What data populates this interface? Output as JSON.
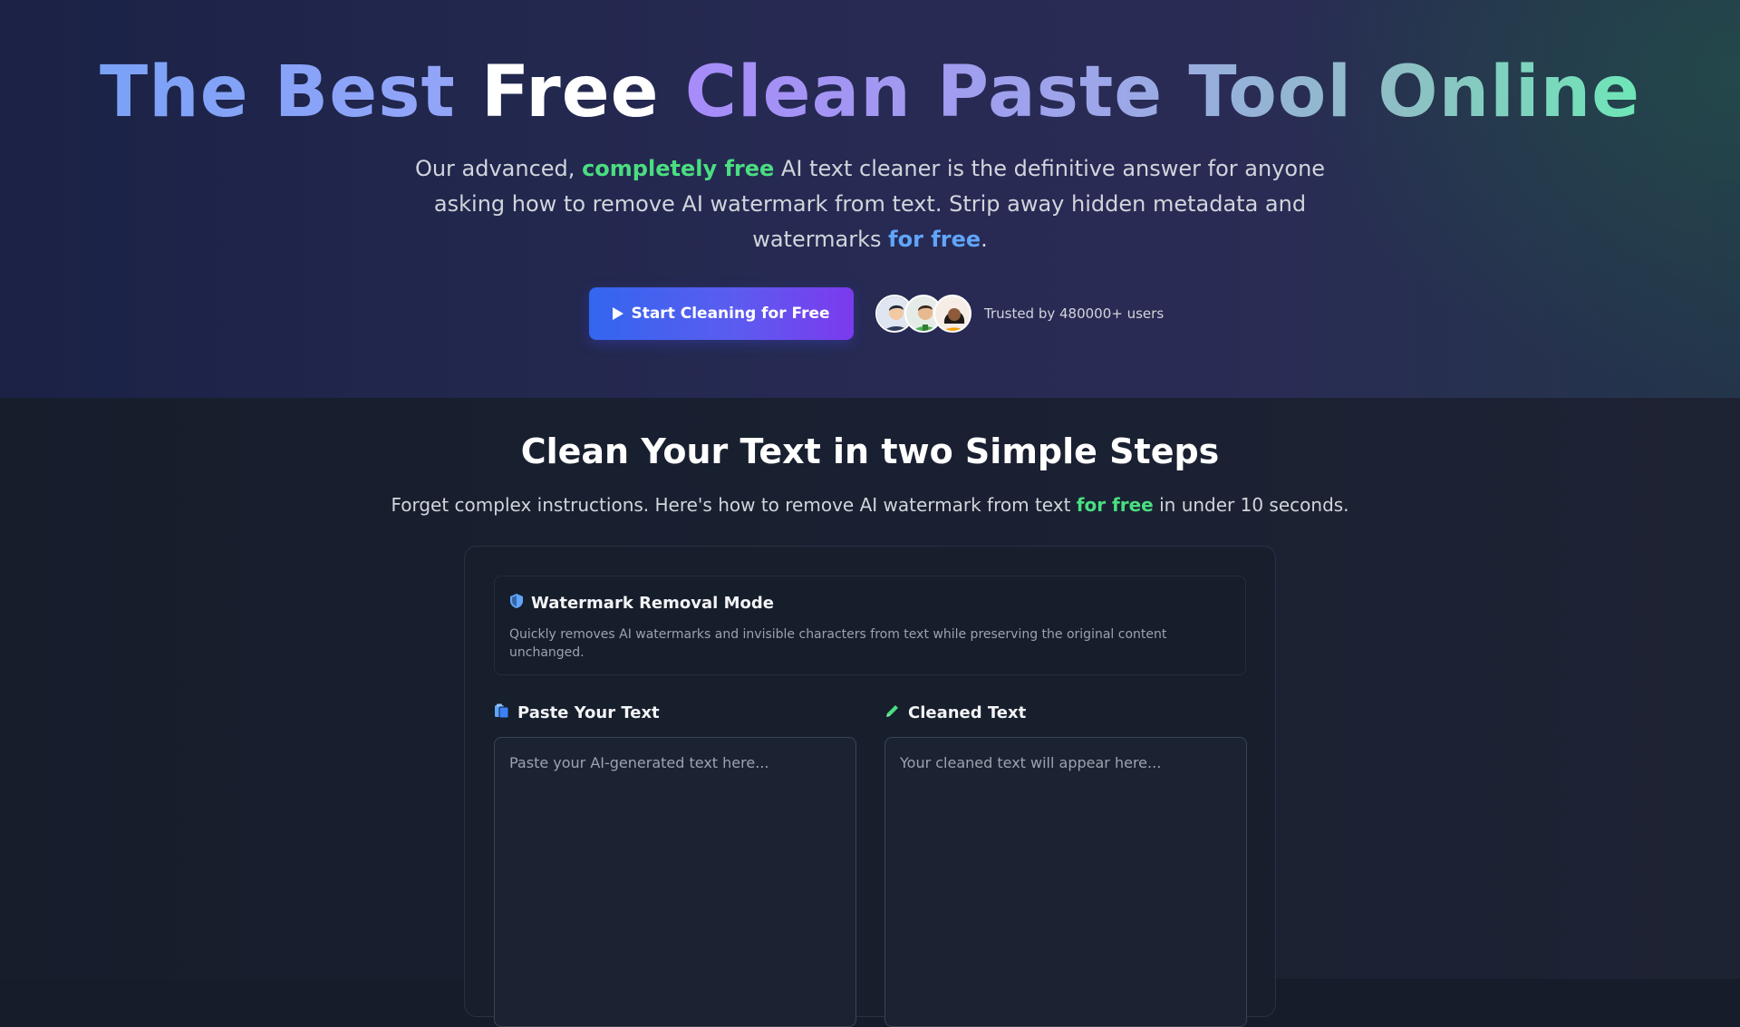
{
  "hero": {
    "title_part1": "The Best",
    "title_part2": "Free",
    "title_part3": "Clean Paste Tool Online",
    "subtitle_pre": "Our advanced, ",
    "subtitle_hl1": "completely free",
    "subtitle_mid": " AI text cleaner is the definitive answer for anyone asking how to remove AI watermark from text. Strip away hidden metadata and watermarks ",
    "subtitle_hl2": "for free",
    "subtitle_post": ".",
    "cta_label": "Start Cleaning for Free",
    "trusted_text": "Trusted by 480000+ users",
    "avatar_icons": [
      "man-avatar",
      "man-green-shirt-avatar",
      "woman-avatar"
    ]
  },
  "steps": {
    "title": "Clean Your Text in two Simple Steps",
    "subtitle_pre": "Forget complex instructions. Here's how to remove AI watermark from text ",
    "subtitle_hl": "for free",
    "subtitle_post": " in under 10 seconds."
  },
  "tool": {
    "mode_title": "Watermark Removal Mode",
    "mode_icon": "shield-icon",
    "mode_description": "Quickly removes AI watermarks and invisible characters from text while preserving the original content unchanged.",
    "input_label": "Paste Your Text",
    "input_icon": "clipboard-icon",
    "input_placeholder": "Paste your AI-generated text here...",
    "output_label": "Cleaned Text",
    "output_icon": "pencil-icon",
    "output_placeholder": "Your cleaned text will appear here..."
  },
  "colors": {
    "accent_green": "#4ade80",
    "accent_blue": "#60a5fa",
    "button_start": "#3366ee",
    "button_end": "#7c3aed",
    "background": "#151c2a"
  }
}
